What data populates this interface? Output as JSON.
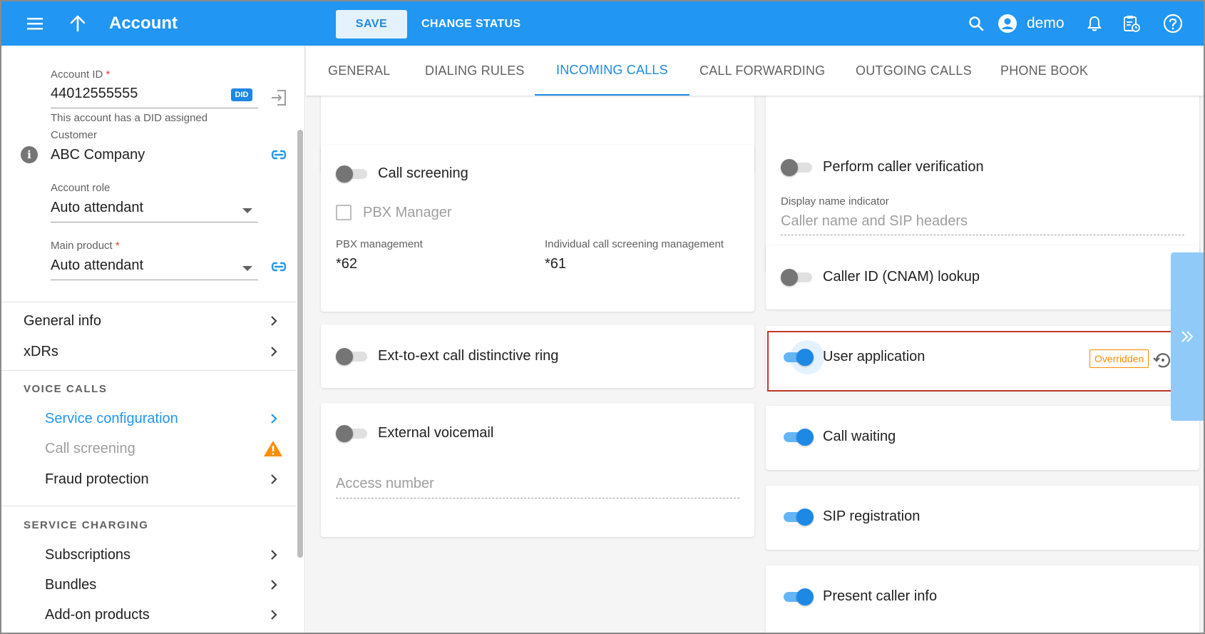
{
  "header": {
    "title": "Account",
    "save_label": "SAVE",
    "change_status_label": "CHANGE STATUS",
    "username": "demo"
  },
  "sidebar": {
    "account_id": {
      "label": "Account ID",
      "required_mark": "*",
      "value": "44012555555",
      "badge": "DID",
      "hint": "This account has a DID assigned"
    },
    "customer": {
      "label": "Customer",
      "value": "ABC Company"
    },
    "account_role": {
      "label": "Account role",
      "value": "Auto attendant"
    },
    "main_product": {
      "label": "Main product",
      "required_mark": "*",
      "value": "Auto attendant"
    },
    "nav_top": [
      {
        "label": "General info"
      },
      {
        "label": "xDRs"
      }
    ],
    "voice_calls": {
      "header": "VOICE CALLS",
      "items": [
        {
          "label": "Service configuration",
          "state": "active"
        },
        {
          "label": "Call screening",
          "state": "warning"
        },
        {
          "label": "Fraud protection",
          "state": "normal"
        }
      ]
    },
    "service_charging": {
      "header": "SERVICE CHARGING",
      "items": [
        {
          "label": "Subscriptions"
        },
        {
          "label": "Bundles"
        },
        {
          "label": "Add-on products"
        }
      ]
    }
  },
  "tabs": [
    {
      "label": "GENERAL",
      "selected": false
    },
    {
      "label": "DIALING RULES",
      "selected": false
    },
    {
      "label": "INCOMING CALLS",
      "selected": true
    },
    {
      "label": "CALL FORWARDING",
      "selected": false
    },
    {
      "label": "OUTGOING CALLS",
      "selected": false
    },
    {
      "label": "PHONE BOOK",
      "selected": false
    }
  ],
  "left_cards": {
    "call_screening": {
      "title": "Call screening",
      "enabled": false,
      "pbx_manager_label": "PBX Manager",
      "pbx_management_label": "PBX management",
      "pbx_management_value": "*62",
      "individual_label": "Individual call screening management",
      "individual_value": "*61"
    },
    "distinctive_ring": {
      "title": "Ext-to-ext call distinctive ring",
      "enabled": false
    },
    "external_voicemail": {
      "title": "External voicemail",
      "enabled": false,
      "access_number_placeholder": "Access number"
    }
  },
  "right_cards": {
    "caller_verification": {
      "title": "Perform caller verification",
      "enabled": false,
      "display_name_label": "Display name indicator",
      "display_name_value": "Caller name and SIP headers"
    },
    "cnam_lookup": {
      "title": "Caller ID (CNAM) lookup",
      "enabled": false
    },
    "user_application": {
      "title": "User application",
      "enabled": true,
      "badge": "Overridden"
    },
    "call_waiting": {
      "title": "Call waiting",
      "enabled": true
    },
    "sip_registration": {
      "title": "SIP registration",
      "enabled": true
    },
    "present_caller_info": {
      "title": "Present caller info",
      "enabled": true
    }
  },
  "colors": {
    "primary": "#2196f3",
    "accent_dark": "#1e88e5",
    "warning": "#fb8c00",
    "highlight_border": "#c0392b"
  }
}
